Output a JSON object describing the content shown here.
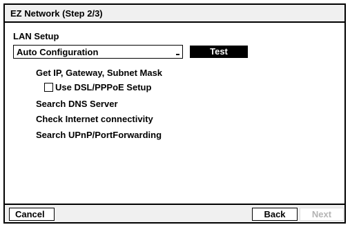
{
  "window": {
    "title": "EZ Network (Step 2/3)"
  },
  "lan_setup": {
    "label": "LAN Setup",
    "mode_select": {
      "selected": "Auto Configuration"
    },
    "test_label": "Test"
  },
  "steps": {
    "get_ip": "Get IP, Gateway, Subnet Mask",
    "use_dsl": {
      "label": "Use DSL/PPPoE Setup",
      "checked": false
    },
    "search_dns": "Search DNS Server",
    "check_internet": "Check Internet connectivity",
    "search_upnp": "Search UPnP/PortForwarding"
  },
  "footer": {
    "cancel_label": "Cancel",
    "back_label": "Back",
    "next_label": "Next",
    "next_enabled": false
  },
  "colors": {
    "border": "#000000",
    "bar_background": "#f0f0f0",
    "disabled_text": "#b4b4b4"
  }
}
